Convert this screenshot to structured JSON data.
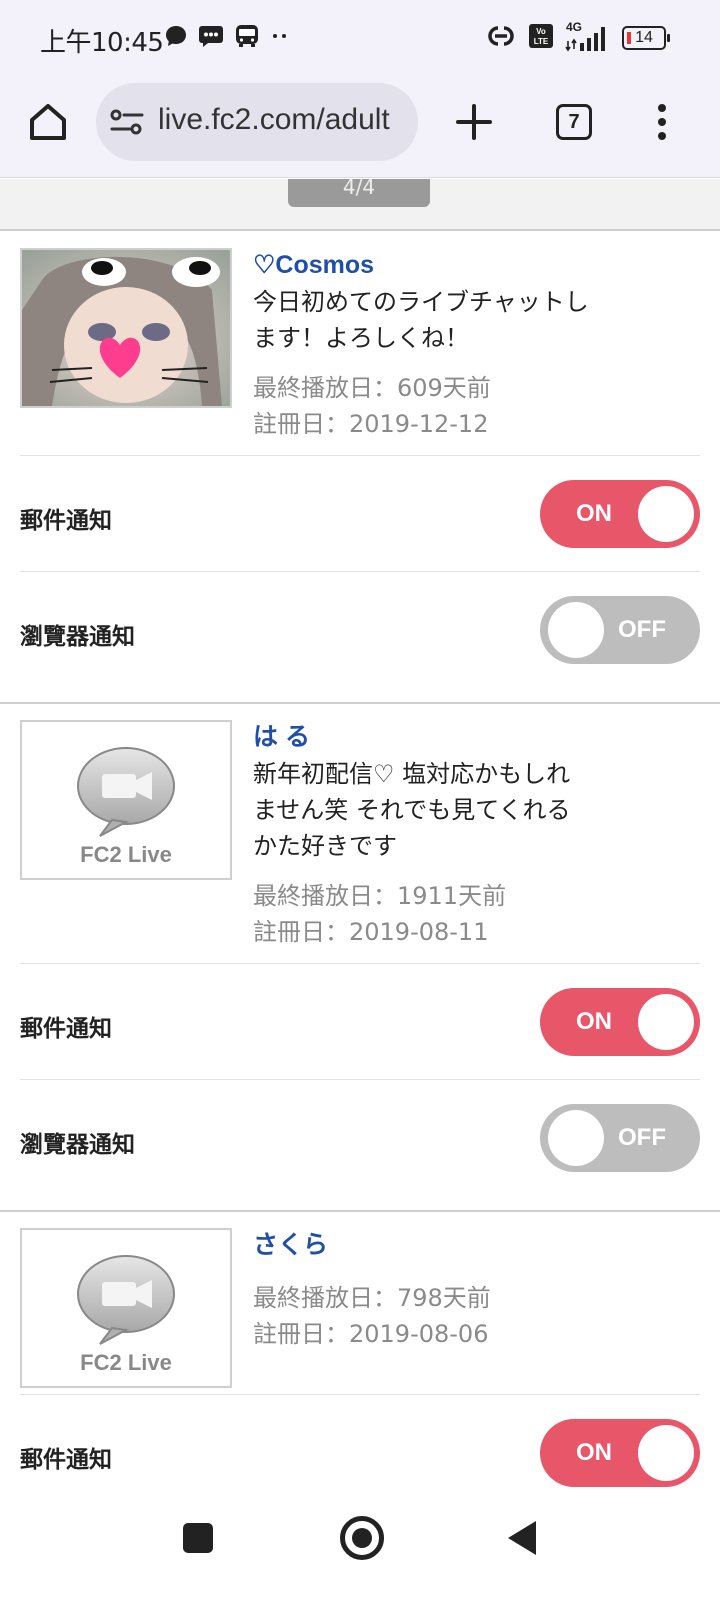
{
  "status_bar": {
    "time": "上午10:45",
    "network": "4G",
    "battery": "14"
  },
  "browser": {
    "url": "live.fc2.com/adult",
    "tab_count": "7"
  },
  "pager": {
    "label": "4/4"
  },
  "placeholder_logo": "FC2 Live",
  "entries": [
    {
      "name": "♡Cosmos",
      "description": "今日初めてのライブチャットします！よろしくね！",
      "last_broadcast": "最終播放日：609天前",
      "registered": "註冊日：2019-12-12",
      "mail_label": "郵件通知",
      "mail_state": "ON",
      "browser_label": "瀏覽器通知",
      "browser_state": "OFF"
    },
    {
      "name": "は る",
      "description": "新年初配信♡ 塩対応かもしれません笑 それでも見てくれるかた好きです",
      "last_broadcast": "最終播放日：1911天前",
      "registered": "註冊日：2019-08-11",
      "mail_label": "郵件通知",
      "mail_state": "ON",
      "browser_label": "瀏覽器通知",
      "browser_state": "OFF"
    },
    {
      "name": "さくら",
      "description": "",
      "last_broadcast": "最終播放日：798天前",
      "registered": "註冊日：2019-08-06",
      "mail_label": "郵件通知",
      "mail_state": "ON"
    }
  ],
  "colors": {
    "accent_on": "#e8566a",
    "toggle_off": "#bdbdbd",
    "name_link": "#1f4fa8"
  }
}
